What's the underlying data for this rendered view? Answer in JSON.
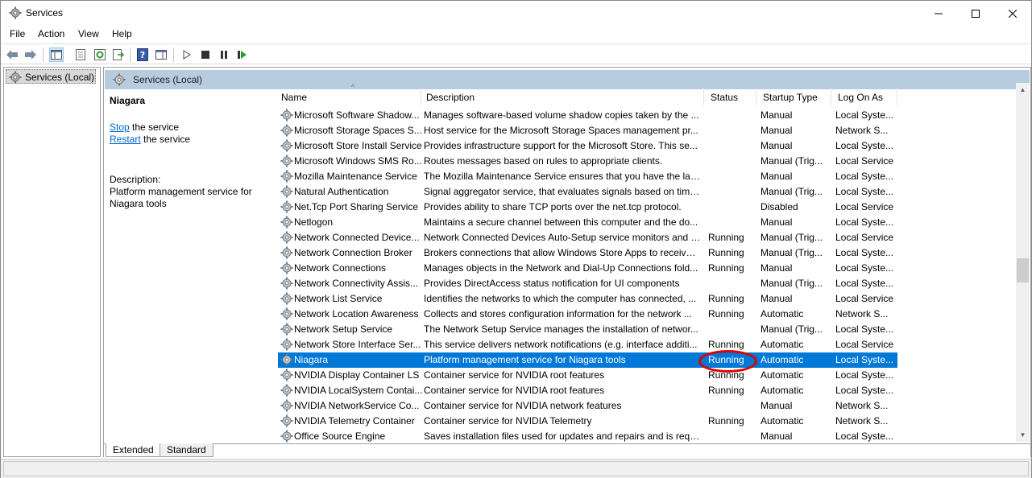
{
  "window": {
    "title": "Services"
  },
  "menu": [
    "File",
    "Action",
    "View",
    "Help"
  ],
  "tree": {
    "root_label": "Services (Local)"
  },
  "pane": {
    "header": "Services (Local)"
  },
  "detail": {
    "service_name": "Niagara",
    "stop_link": "Stop",
    "stop_rest": " the service",
    "restart_link": "Restart",
    "restart_rest": " the service",
    "description_label": "Description:",
    "description_text": "Platform management service for Niagara tools"
  },
  "columns": [
    "Name",
    "Description",
    "Status",
    "Startup Type",
    "Log On As"
  ],
  "rows": [
    {
      "name": "Microsoft Software Shadow...",
      "desc": "Manages software-based volume shadow copies taken by the ...",
      "status": "",
      "startup": "Manual",
      "logon": "Local Syste..."
    },
    {
      "name": "Microsoft Storage Spaces S...",
      "desc": "Host service for the Microsoft Storage Spaces management pr...",
      "status": "",
      "startup": "Manual",
      "logon": "Network S..."
    },
    {
      "name": "Microsoft Store Install Service",
      "desc": "Provides infrastructure support for the Microsoft Store.  This se...",
      "status": "",
      "startup": "Manual",
      "logon": "Local Syste..."
    },
    {
      "name": "Microsoft Windows SMS Ro...",
      "desc": "Routes messages based on rules to appropriate clients.",
      "status": "",
      "startup": "Manual (Trig...",
      "logon": "Local Service"
    },
    {
      "name": "Mozilla Maintenance Service",
      "desc": "The Mozilla Maintenance Service ensures that you have the lat...",
      "status": "",
      "startup": "Manual",
      "logon": "Local Syste..."
    },
    {
      "name": "Natural Authentication",
      "desc": "Signal aggregator service, that evaluates signals based on time,...",
      "status": "",
      "startup": "Manual (Trig...",
      "logon": "Local Syste..."
    },
    {
      "name": "Net.Tcp Port Sharing Service",
      "desc": "Provides ability to share TCP ports over the net.tcp protocol.",
      "status": "",
      "startup": "Disabled",
      "logon": "Local Service"
    },
    {
      "name": "Netlogon",
      "desc": "Maintains a secure channel between this computer and the do...",
      "status": "",
      "startup": "Manual",
      "logon": "Local Syste..."
    },
    {
      "name": "Network Connected Device...",
      "desc": "Network Connected Devices Auto-Setup service monitors and i...",
      "status": "Running",
      "startup": "Manual (Trig...",
      "logon": "Local Service"
    },
    {
      "name": "Network Connection Broker",
      "desc": "Brokers connections that allow Windows Store Apps to receive ...",
      "status": "Running",
      "startup": "Manual (Trig...",
      "logon": "Local Syste..."
    },
    {
      "name": "Network Connections",
      "desc": "Manages objects in the Network and Dial-Up Connections fold...",
      "status": "Running",
      "startup": "Manual",
      "logon": "Local Syste..."
    },
    {
      "name": "Network Connectivity Assis...",
      "desc": "Provides DirectAccess status notification for UI components",
      "status": "",
      "startup": "Manual (Trig...",
      "logon": "Local Syste..."
    },
    {
      "name": "Network List Service",
      "desc": "Identifies the networks to which the computer has connected, ...",
      "status": "Running",
      "startup": "Manual",
      "logon": "Local Service"
    },
    {
      "name": "Network Location Awareness",
      "desc": "Collects and stores configuration information for the network ...",
      "status": "Running",
      "startup": "Automatic",
      "logon": "Network S..."
    },
    {
      "name": "Network Setup Service",
      "desc": "The Network Setup Service manages the installation of networ...",
      "status": "",
      "startup": "Manual (Trig...",
      "logon": "Local Syste..."
    },
    {
      "name": "Network Store Interface Ser...",
      "desc": "This service delivers network notifications (e.g. interface additi...",
      "status": "Running",
      "startup": "Automatic",
      "logon": "Local Service"
    },
    {
      "name": "Niagara",
      "desc": "Platform management service for Niagara tools",
      "status": "Running",
      "startup": "Automatic",
      "logon": "Local Syste...",
      "selected": true
    },
    {
      "name": "NVIDIA Display Container LS",
      "desc": "Container service for NVIDIA root features",
      "status": "Running",
      "startup": "Automatic",
      "logon": "Local Syste..."
    },
    {
      "name": "NVIDIA LocalSystem Contai...",
      "desc": "Container service for NVIDIA root features",
      "status": "Running",
      "startup": "Automatic",
      "logon": "Local Syste..."
    },
    {
      "name": "NVIDIA NetworkService Co...",
      "desc": "Container service for NVIDIA network features",
      "status": "",
      "startup": "Manual",
      "logon": "Network S..."
    },
    {
      "name": "NVIDIA Telemetry Container",
      "desc": "Container service for NVIDIA Telemetry",
      "status": "Running",
      "startup": "Automatic",
      "logon": "Network S..."
    },
    {
      "name": "Office  Source Engine",
      "desc": "Saves installation files used for updates and repairs and is requi...",
      "status": "",
      "startup": "Manual",
      "logon": "Local Syste..."
    }
  ],
  "tabs": [
    "Extended",
    "Standard"
  ],
  "colors": {
    "selection": "#0078d7",
    "header_band": "#b8cce0",
    "annotation": "#e00000",
    "link": "#0066cc"
  }
}
